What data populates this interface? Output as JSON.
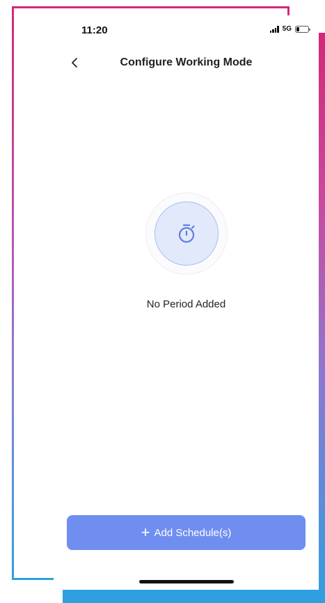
{
  "status_bar": {
    "time": "11:20",
    "network": "5G",
    "battery_level": 0.25
  },
  "nav": {
    "back_icon": "chevron-left-icon",
    "title": "Configure Working Mode"
  },
  "empty_state": {
    "icon": "stopwatch-icon",
    "message": "No Period Added"
  },
  "actions": {
    "add_schedule_icon": "plus-icon",
    "add_schedule_label": "Add Schedule(s)"
  },
  "colors": {
    "primary_button": "#6f8ef0",
    "icon_accent": "#5e7fe0",
    "icon_bg": "#e2e9fb",
    "frame_top": "#d3277a",
    "frame_bottom": "#2f9fe0"
  }
}
